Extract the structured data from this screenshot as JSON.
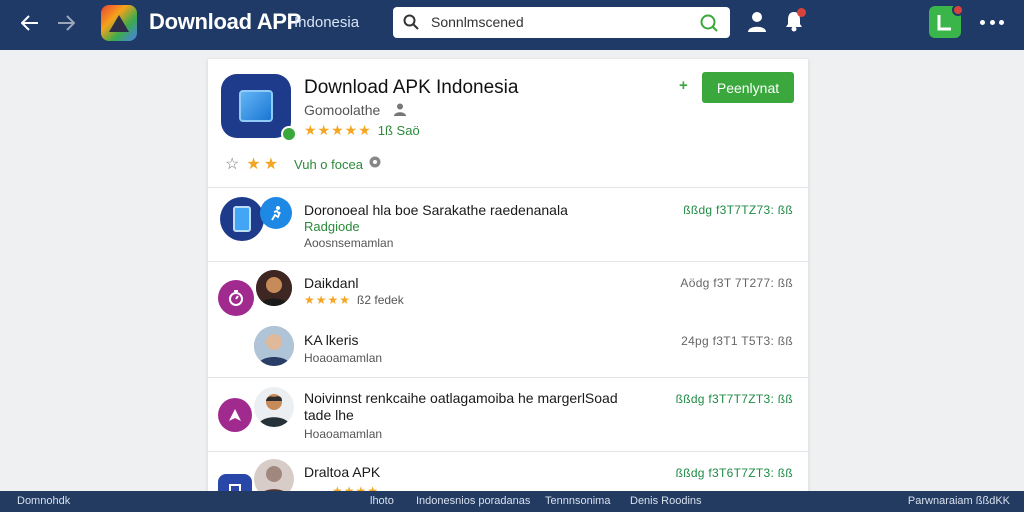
{
  "header": {
    "brand": "Download APP",
    "brand_sub": "Indonesia",
    "search_placeholder": "Sonnlmscened"
  },
  "hero": {
    "title": "Download APK Indonesia",
    "subtitle": "Gomoolathe",
    "rating_stars": "★★★★★",
    "rating_text": "1ß Saö",
    "install_label": "Peenlynat",
    "plus": "+",
    "link_text": "Vuh o focea",
    "row_star_1": "☆",
    "row_star_2": "★",
    "row_star_3": "★"
  },
  "list": [
    {
      "title": "Doronoeal hla boe Sarakathe raedenanala",
      "green": "Radgiode",
      "sub": "Aoosnsemamlan",
      "meta": "ßßdg f3T7TZ73: ßß"
    },
    {
      "title": "Daikdanl",
      "stars": "★★★★",
      "rating_text": "ß2 fedek",
      "meta": "Aödg f3T 7T277: ßß"
    },
    {
      "title": "KA lkeris",
      "sub": "Hoaoamamlan",
      "meta": "24pg f3T1 T5T3: ßß"
    },
    {
      "title": "Noivinnst renkcaihe oatlagamoiba he margerlSoad",
      "title2": "tade lhe",
      "sub": "Hoaoamamlan",
      "meta": "ßßdg f3T7T7ZT3: ßß"
    },
    {
      "title": "Draltoa APK",
      "stars": "★★★★",
      "meta": "ßßdg f3T6T7ZT3: ßß"
    }
  ],
  "footer": {
    "left": "Domnohdk",
    "links": [
      "lhoto",
      "Indonesnios poradanas",
      "Tennnsonima",
      "Denis Roodins"
    ],
    "right": "Parwnaraiam ßßdKK"
  },
  "colors": {
    "topbar": "#1f3a66",
    "install_button": "#3aa83c",
    "footer": "#233b61"
  }
}
